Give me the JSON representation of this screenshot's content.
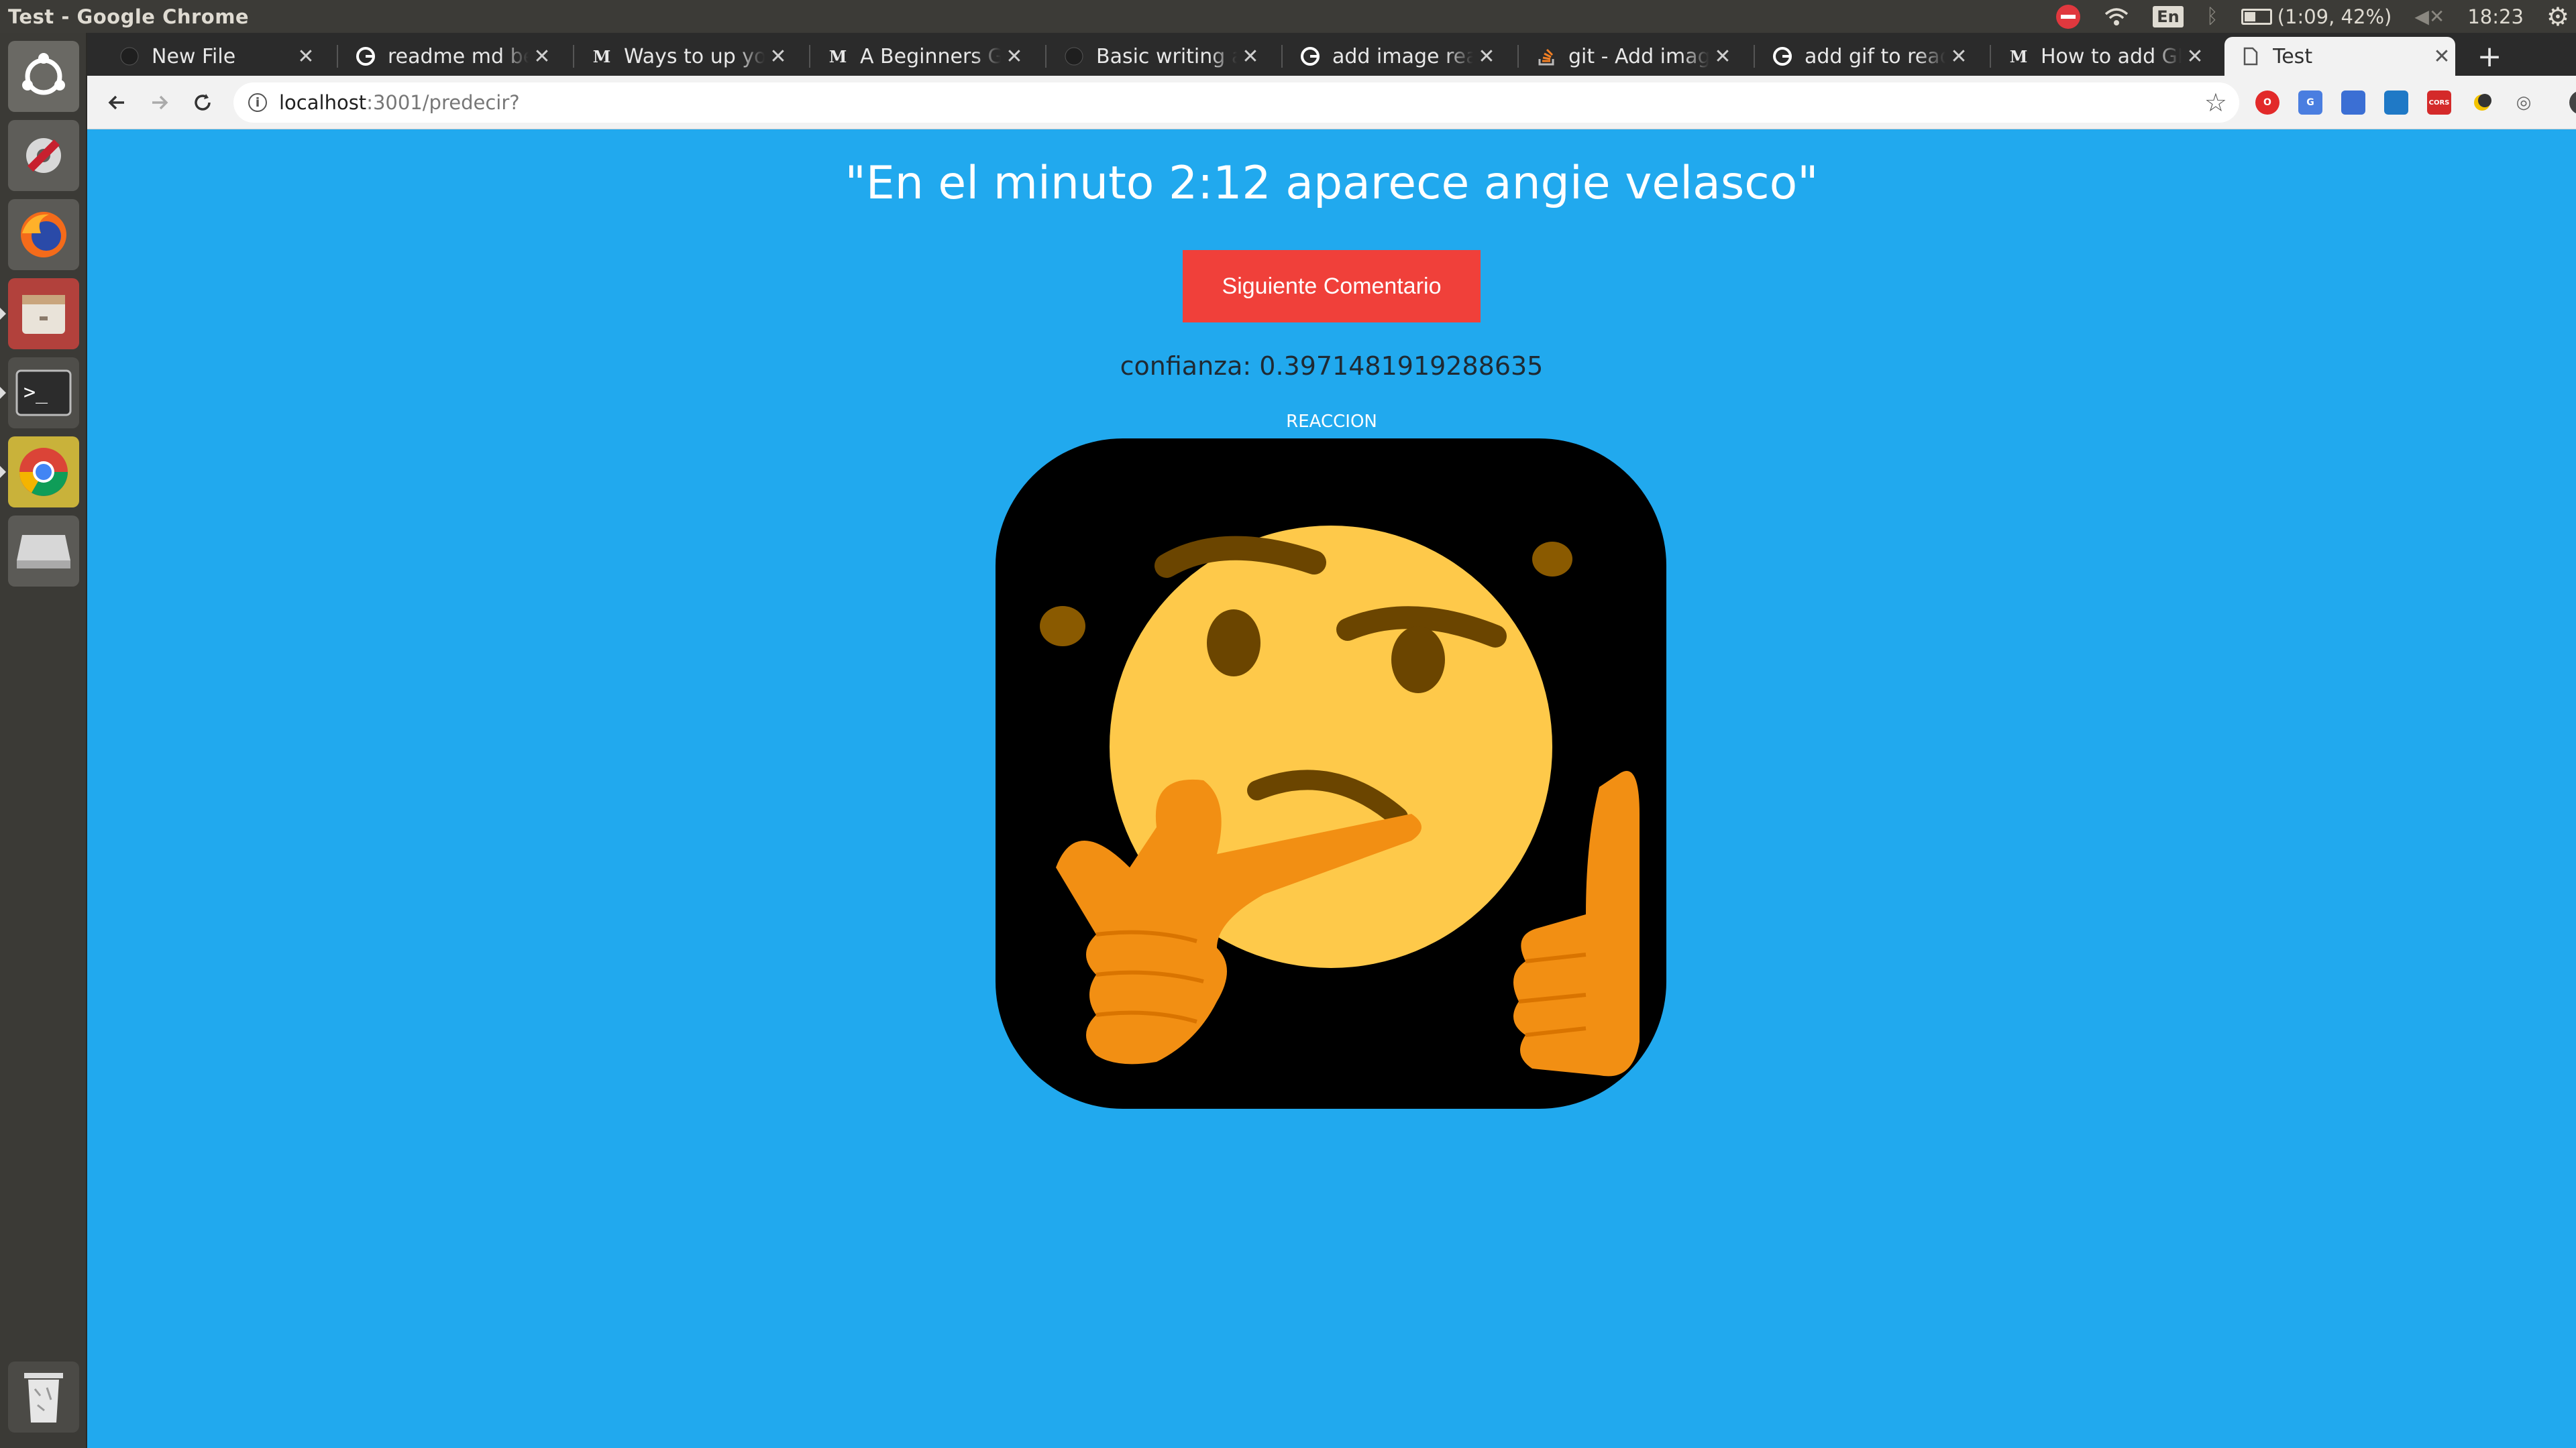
{
  "os": {
    "window_title": "Test - Google Chrome",
    "tray": {
      "keyboard_layout": "En",
      "battery": "(1:09, 42%)",
      "clock": "18:23"
    },
    "launcher_items": [
      {
        "name": "ubuntu-dash-icon"
      },
      {
        "name": "system-settings-icon"
      },
      {
        "name": "firefox-icon"
      },
      {
        "name": "files-icon"
      },
      {
        "name": "terminal-icon"
      },
      {
        "name": "chrome-icon"
      },
      {
        "name": "disk-icon"
      },
      {
        "name": "trash-icon"
      }
    ]
  },
  "browser": {
    "tabs": [
      {
        "title": "New File",
        "favicon": "github-icon"
      },
      {
        "title": "readme md beautiful",
        "favicon": "google-icon"
      },
      {
        "title": "Ways to up your",
        "favicon": "medium-icon"
      },
      {
        "title": "A Beginners Guide",
        "favicon": "medium-icon"
      },
      {
        "title": "Basic writing and",
        "favicon": "github-icon"
      },
      {
        "title": "add image readme",
        "favicon": "google-icon"
      },
      {
        "title": "git - Add images",
        "favicon": "stackoverflow-icon"
      },
      {
        "title": "add gif to readme",
        "favicon": "google-icon"
      },
      {
        "title": "How to add GIFs",
        "favicon": "medium-icon"
      },
      {
        "title": "Test",
        "favicon": "page-icon",
        "active": true
      }
    ],
    "address_bar": {
      "host": "localhost",
      "path": ":3001/predecir?"
    },
    "extensions": [
      "opera-icon",
      "translate-icon",
      "calendar-icon",
      "trello-icon",
      "cors-icon",
      "moon-icon",
      "mask-icon",
      "profile-icon"
    ]
  },
  "page": {
    "comment": "\"En el minuto 2:12 aparece angie velasco\"",
    "next_button_label": "Siguiente Comentario",
    "confidence": "confianza: 0.3971481919288635",
    "reaction_label": "REACCION",
    "reaction_emoji": "thinking-face",
    "colors": {
      "background": "#21a9ee",
      "button": "#f0403a",
      "emoji_face": "#fec94a",
      "emoji_hand": "#f28f13",
      "emoji_frame": "#000000"
    }
  }
}
